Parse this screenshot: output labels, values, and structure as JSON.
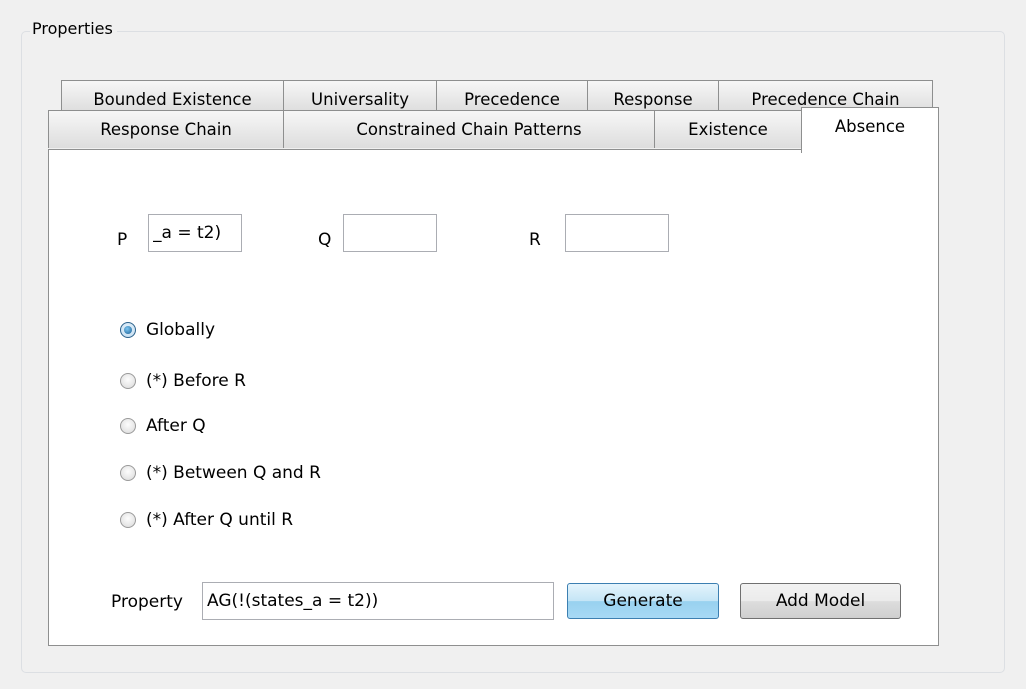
{
  "group": {
    "title": "Properties"
  },
  "tabs": {
    "row1": [
      "Bounded Existence",
      "Universality",
      "Precedence",
      "Response",
      "Precedence Chain"
    ],
    "row2": [
      "Response Chain",
      "Constrained Chain Patterns",
      "Existence",
      "Absence"
    ],
    "active": "Absence"
  },
  "fields": {
    "p_label": "P",
    "p_value": "_a = t2)",
    "q_label": "Q",
    "q_value": "",
    "r_label": "R",
    "r_value": ""
  },
  "scope": {
    "options": [
      "Globally",
      "(*) Before R",
      "After Q",
      "(*) Between Q and R",
      "(*) After Q until R"
    ],
    "selected": "Globally"
  },
  "property": {
    "label": "Property",
    "value": "AG(!(states_a = t2))"
  },
  "buttons": {
    "generate": "Generate",
    "add_model": "Add Model"
  }
}
